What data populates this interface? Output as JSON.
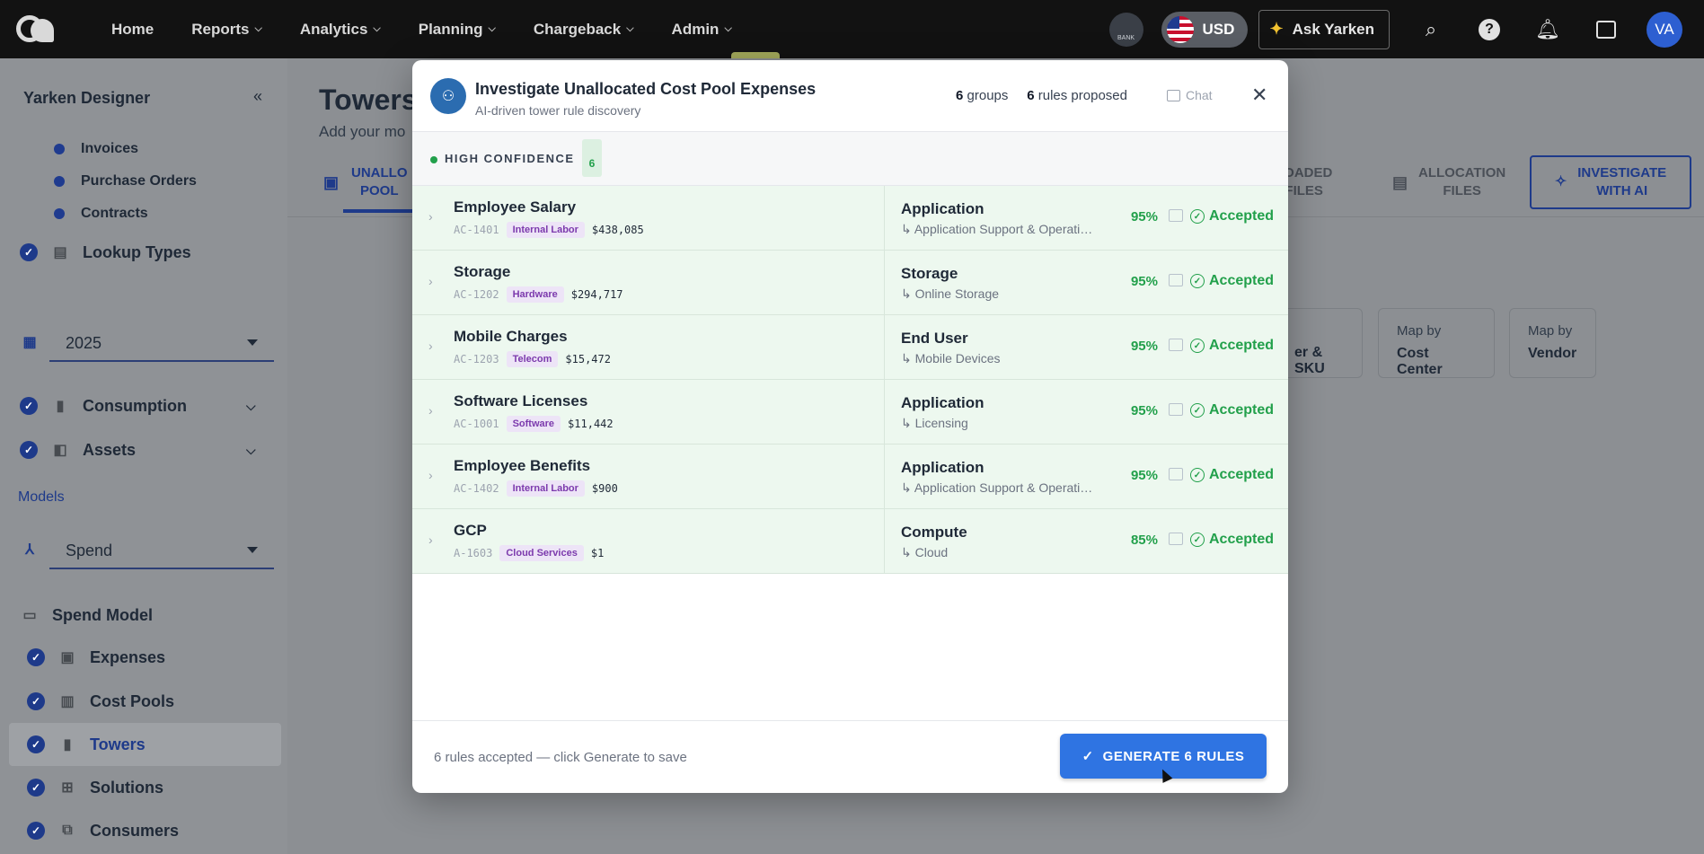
{
  "topnav": {
    "items": [
      {
        "label": "Home",
        "dropdown": false
      },
      {
        "label": "Reports",
        "dropdown": true
      },
      {
        "label": "Analytics",
        "dropdown": true
      },
      {
        "label": "Planning",
        "dropdown": true
      },
      {
        "label": "Chargeback",
        "dropdown": true
      },
      {
        "label": "Admin",
        "dropdown": true
      }
    ],
    "bank_label": "BANK",
    "currency": "USD",
    "ask_label": "Ask Yarken",
    "avatar_initials": "VA",
    "icons": [
      "search-icon",
      "help-icon",
      "bell-icon",
      "inbox-icon"
    ]
  },
  "sidebar": {
    "title": "Yarken Designer",
    "sub_items": [
      "Invoices",
      "Purchase Orders",
      "Contracts"
    ],
    "lookup_types": "Lookup Types",
    "year": "2025",
    "consumption": "Consumption",
    "assets": "Assets",
    "models_label": "Models",
    "model_select": "Spend",
    "spend_model": "Spend Model",
    "model_items": [
      "Expenses",
      "Cost Pools",
      "Towers",
      "Solutions",
      "Consumers"
    ]
  },
  "main": {
    "title": "Towers",
    "subtitle": "Add your mo",
    "tab_unallocated": [
      "UNALLO",
      "POOL"
    ],
    "tab_loaded": [
      "LOADED",
      "FILES"
    ],
    "tab_allocation": [
      "ALLOCATION",
      "FILES"
    ],
    "investigate_button": [
      "INVESTIGATE",
      "WITH AI"
    ],
    "map_cards": [
      {
        "l1": "",
        "l2": "er & SKU"
      },
      {
        "l1": "Map by",
        "l2": "Cost Center"
      },
      {
        "l1": "Map by",
        "l2": "Vendor"
      }
    ]
  },
  "modal": {
    "title": "Investigate Unallocated Cost Pool Expenses",
    "subtitle": "AI-driven tower rule discovery",
    "groups_count": "6",
    "groups_label": "groups",
    "rules_count": "6",
    "rules_label": "rules proposed",
    "chat_label": "Chat",
    "confidence_label": "HIGH CONFIDENCE",
    "confidence_count": "6",
    "rows": [
      {
        "name": "Employee Salary",
        "code": "AC-1401",
        "tag": "Internal Labor",
        "amount": "$438,085",
        "tower": "Application",
        "sub_tower": "↳ Application Support & Operations",
        "pct": "95%",
        "status": "Accepted"
      },
      {
        "name": "Storage",
        "code": "AC-1202",
        "tag": "Hardware",
        "amount": "$294,717",
        "tower": "Storage",
        "sub_tower": "↳ Online Storage",
        "pct": "95%",
        "status": "Accepted"
      },
      {
        "name": "Mobile Charges",
        "code": "AC-1203",
        "tag": "Telecom",
        "amount": "$15,472",
        "tower": "End User",
        "sub_tower": "↳ Mobile Devices",
        "pct": "95%",
        "status": "Accepted"
      },
      {
        "name": "Software Licenses",
        "code": "AC-1001",
        "tag": "Software",
        "amount": "$11,442",
        "tower": "Application",
        "sub_tower": "↳ Licensing",
        "pct": "95%",
        "status": "Accepted"
      },
      {
        "name": "Employee Benefits",
        "code": "AC-1402",
        "tag": "Internal Labor",
        "amount": "$900",
        "tower": "Application",
        "sub_tower": "↳ Application Support & Operations",
        "pct": "95%",
        "status": "Accepted"
      },
      {
        "name": "GCP",
        "code": "A-1603",
        "tag": "Cloud Services",
        "amount": "$1",
        "tower": "Compute",
        "sub_tower": "↳ Cloud",
        "pct": "85%",
        "status": "Accepted"
      }
    ],
    "footer_text": "6 rules accepted — click Generate to save",
    "generate_label": "GENERATE 6 RULES"
  }
}
